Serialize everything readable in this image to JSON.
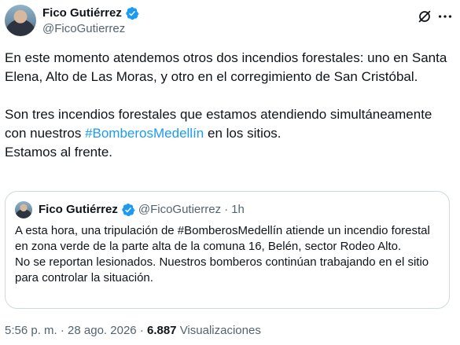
{
  "author": {
    "display_name": "Fico Gutiérrez",
    "handle": "@FicoGutierrez",
    "verified": true,
    "avatar_icon": "profile-photo"
  },
  "icons": {
    "grok": "grok-slash-icon",
    "more": "more-dots-icon",
    "verified": "verified-badge-icon",
    "accent": "#1d9bf0"
  },
  "tweet": {
    "paragraph1": "En este momento atendemos otros dos incendios forestales: uno en Santa Elena, Alto de Las Moras, y otro en el corregimiento de San Cristóbal.",
    "paragraph2_before": "Son tres incendios forestales que estamos atendiendo simultáneamente con nuestros ",
    "paragraph2_hashtag": "#BomberosMedellín",
    "paragraph2_after": " en los sitios.",
    "paragraph3": "Estamos al frente."
  },
  "quote": {
    "display_name": "Fico Gutiérrez",
    "handle": "@FicoGutierrez",
    "separator": "·",
    "time": "1h",
    "text1": "A esta hora, una tripulación de #BomberosMedellín atiende un incendio forestal en zona verde de la parte alta de la comuna 16, Belén, sector Rodeo Alto.",
    "text2": "No se reportan lesionados. Nuestros bomberos continúan trabajando en el sitio para controlar la situación."
  },
  "footer": {
    "time": "5:56 p. m.",
    "separator": "·",
    "date": "28 ago. 2026",
    "views_count": "6.887",
    "views_label": "Visualizaciones"
  }
}
